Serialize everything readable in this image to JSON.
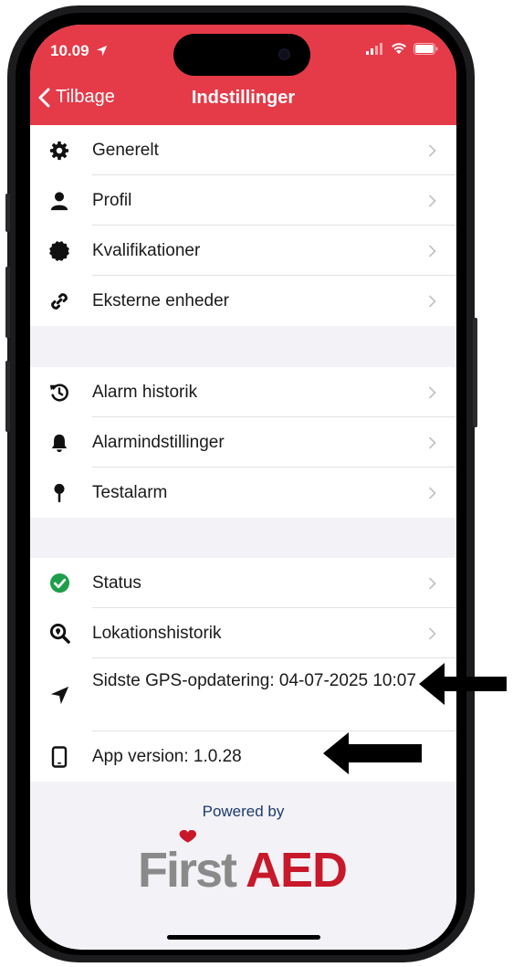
{
  "status_bar": {
    "time": "10.09"
  },
  "nav": {
    "back_label": "Tilbage",
    "title": "Indstillinger"
  },
  "groups": [
    {
      "items": [
        {
          "label": "Generelt",
          "icon": "gear-icon"
        },
        {
          "label": "Profil",
          "icon": "person-icon"
        },
        {
          "label": "Kvalifikationer",
          "icon": "badge-icon"
        },
        {
          "label": "Eksterne enheder",
          "icon": "link-icon"
        }
      ]
    },
    {
      "items": [
        {
          "label": "Alarm historik",
          "icon": "history-icon"
        },
        {
          "label": "Alarmindstillinger",
          "icon": "bell-icon"
        },
        {
          "label": "Testalarm",
          "icon": "pin-icon"
        }
      ]
    },
    {
      "items": [
        {
          "label": "Status",
          "icon": "check-circle-icon"
        },
        {
          "label": "Lokationshistorik",
          "icon": "search-location-icon"
        },
        {
          "label": "Sidste GPS-opdatering: 04-07-2025 10:07",
          "icon": "location-arrow-icon"
        },
        {
          "label": "App version: 1.0.28",
          "icon": "phone-icon"
        }
      ]
    }
  ],
  "footer": {
    "powered_by": "Powered by",
    "logo_text_left": "First",
    "logo_text_right": "AED"
  },
  "colors": {
    "header": "#e53a48",
    "status_ok": "#1e9e4a",
    "logo_gray": "#8a8a8a",
    "logo_red": "#c8192b"
  }
}
